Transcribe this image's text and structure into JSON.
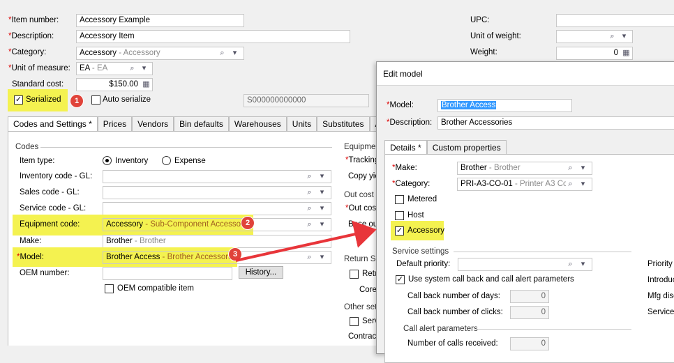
{
  "top": {
    "item_number_label": "Item number:",
    "item_number": "Accessory Example",
    "description_label": "Description:",
    "description": "Accessory Item",
    "category_label": "Category:",
    "category_main": "Accessory",
    "category_sub": " - Accessory",
    "uom_label": "Unit of measure:",
    "uom_main": "EA",
    "uom_sub": " - EA",
    "standard_cost_label": "Standard cost:",
    "standard_cost": "$150.00",
    "serialized_label": "Serialized",
    "auto_serialize_label": "Auto serialize",
    "serial_value": "S000000000000",
    "upc_label": "UPC:",
    "unit_weight_label": "Unit of weight:",
    "weight_label": "Weight:",
    "weight_value": "0"
  },
  "tabs": [
    "Codes and Settings *",
    "Prices",
    "Vendors",
    "Bin defaults",
    "Warehouses",
    "Units",
    "Substitutes",
    "A"
  ],
  "codes": {
    "section_label": "Codes",
    "item_type_label": "Item type:",
    "inventory_label": "Inventory",
    "expense_label": "Expense",
    "inventory_gl_label": "Inventory code - GL:",
    "sales_gl_label": "Sales code - GL:",
    "service_gl_label": "Service code - GL:",
    "equipment_code_label": "Equipment code:",
    "equipment_main": "Accessory",
    "equipment_sub": " - Sub-Component Accessory",
    "make_label": "Make:",
    "make_main": "Brother",
    "make_sub": " - Brother",
    "model_label": "Model:",
    "model_main": "Brother Access",
    "model_sub": " - Brother Accessories",
    "oem_label": "OEM number:",
    "history_button": "History...",
    "oem_compatible_label": "OEM compatible item"
  },
  "right_partial": {
    "equipment": "Equipmen",
    "tracking": "Tracking",
    "copy_yield": "Copy yie",
    "out_cost": "Out cost s",
    "out_cost2": "Out cost",
    "base_out": "Base out",
    "return_se": "Return Se",
    "retu": "Retu",
    "core": "Core",
    "other_set": "Other set",
    "serv": "Serv",
    "contract": "Contract"
  },
  "dialog": {
    "title": "Edit model",
    "model_label": "Model:",
    "model_value": "Brother Access",
    "description_label": "Description:",
    "description_value": "Brother Accessories",
    "tabs": [
      "Details *",
      "Custom properties"
    ],
    "make_label": "Make:",
    "make_main": "Brother",
    "make_sub": " - Brother",
    "category_label": "Category:",
    "category_main": "PRI-A3-CO-01",
    "category_sub": " - Printer A3 Colo",
    "metered_label": "Metered",
    "host_label": "Host",
    "accessory_label": "Accessory",
    "service_settings_label": "Service settings",
    "default_priority_label": "Default priority:",
    "use_system_label": "Use system call back and call alert parameters",
    "callback_days_label": "Call back number of days:",
    "callback_days": "0",
    "callback_clicks_label": "Call back number of clicks:",
    "callback_clicks": "0",
    "call_alert_label": "Call alert parameters",
    "num_calls_label": "Number of calls received:",
    "num_calls": "0",
    "priority_partial": "Priority v",
    "introduc_partial": "Introduc",
    "mfg_partial": "Mfg disc",
    "service_partial": "Service"
  },
  "badges": [
    "1",
    "2",
    "3"
  ]
}
